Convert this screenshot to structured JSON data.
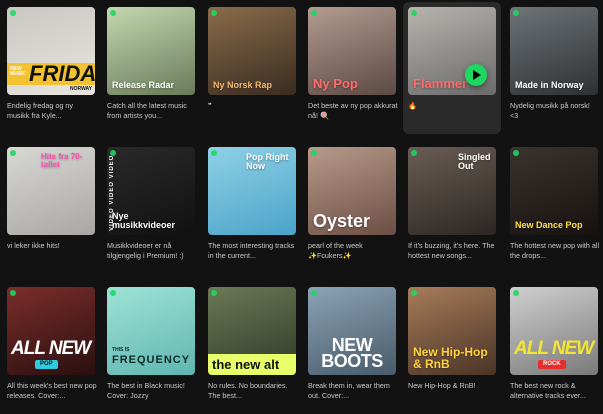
{
  "colors": {
    "background": "#121212",
    "accent": "#1ed760",
    "description_text": "#c9c9c9"
  },
  "icons": {
    "spotify_logo": "spotify-logo-icon",
    "play_button": "play-icon"
  },
  "rows": [
    [
      {
        "id": "friday",
        "banner_small": "NEW MUSIC",
        "banner_big": "FRIDAY",
        "banner_tail": "NORWAY",
        "description": "Endelig fredag og ny musikk fra Kyle...",
        "cover_colors": [
          "#c9c7c2",
          "#e8e5df"
        ]
      },
      {
        "id": "release-radar",
        "title": "Release Radar",
        "description": "Catch all the latest music from artists you...",
        "cover_colors": [
          "#c2d8b0",
          "#6a7a5a"
        ]
      },
      {
        "id": "ny-norsk-rap",
        "title": "Ny Norsk Rap",
        "description": "❞",
        "cover_colors": [
          "#8a6c4c",
          "#3a2c20"
        ]
      },
      {
        "id": "ny-pop",
        "title": "Ny Pop",
        "description": "Det beste av ny pop akkurat nå! 🍭",
        "cover_colors": [
          "#b39b90",
          "#5c4a44"
        ]
      },
      {
        "id": "flammer",
        "title": "Flammer",
        "description": "🔥",
        "cover_colors": [
          "#b7b3ae",
          "#6b6b6b"
        ],
        "active": true
      },
      {
        "id": "made-in-norway",
        "title": "Made in Norway",
        "description": "Nydelig musikk på norsk! <3",
        "cover_colors": [
          "#6f7478",
          "#2d3134"
        ]
      }
    ],
    [
      {
        "id": "hits-fra-70",
        "title": "Hits fra 70-tallet",
        "description": "vi leker ikke hits!",
        "cover_colors": [
          "#d7d7d3",
          "#a9a7a3"
        ]
      },
      {
        "id": "nye-musikkvideoer",
        "title": "Nye musikkvideoer",
        "description": "Musikkvideoer er nå tilgjengelig i Premium! :)",
        "cover_colors": [
          "#2a2a2a",
          "#111111"
        ],
        "vertical_text": "VIDEO VIDEO VIDEO"
      },
      {
        "id": "pop-right-now",
        "title": "Pop Right Now",
        "description": "The most interesting tracks in the current...",
        "cover_colors": [
          "#8fd1e6",
          "#4aa3c9"
        ]
      },
      {
        "id": "oyster",
        "title": "Oyster",
        "description": "pearl of the week ✨Fcukers✨",
        "cover_colors": [
          "#b79a8a",
          "#6d4e45"
        ]
      },
      {
        "id": "singled-out",
        "title": "Singled Out",
        "description": "If it's buzzing, it's here. The hottest new songs...",
        "cover_colors": [
          "#6a5e56",
          "#2c2622"
        ]
      },
      {
        "id": "new-dance-pop",
        "title": "New Dance Pop",
        "description": "The hottest new pop with all the drops...",
        "cover_colors": [
          "#3a3430",
          "#17120f"
        ]
      }
    ],
    [
      {
        "id": "all-new-pop",
        "big": "ALL NEW",
        "tag": "POP",
        "description": "All this week's best new pop releases. Cover:...",
        "cover_colors": [
          "#7b2e2a",
          "#2a0f10"
        ]
      },
      {
        "id": "frequency",
        "small": "THIS IS",
        "title": "FREQUENCY",
        "description": "The best in Black music! Cover: Jozzy",
        "cover_colors": [
          "#9fe2d6",
          "#5fb6b0"
        ]
      },
      {
        "id": "the-new-alt",
        "title": "the new alt",
        "description": "No rules. No boundaries. The best...",
        "cover_colors": [
          "#6b7a56",
          "#2f3a28"
        ]
      },
      {
        "id": "new-boots",
        "title": "NEW BOOTS",
        "description": "Break them in, wear them out. Cover:...",
        "cover_colors": [
          "#8aa3b6",
          "#4a5b6a"
        ]
      },
      {
        "id": "new-hiphop-rnb",
        "title": "New Hip-Hop & RnB",
        "description": "New Hip-Hop & RnB!",
        "cover_colors": [
          "#a77c5a",
          "#4a3426"
        ]
      },
      {
        "id": "all-new-rock",
        "big": "ALL NEW",
        "tag": "ROCK",
        "description": "The best new rock & alternative tracks ever...",
        "cover_colors": [
          "#cfcfcf",
          "#7a7a7a"
        ]
      }
    ]
  ]
}
